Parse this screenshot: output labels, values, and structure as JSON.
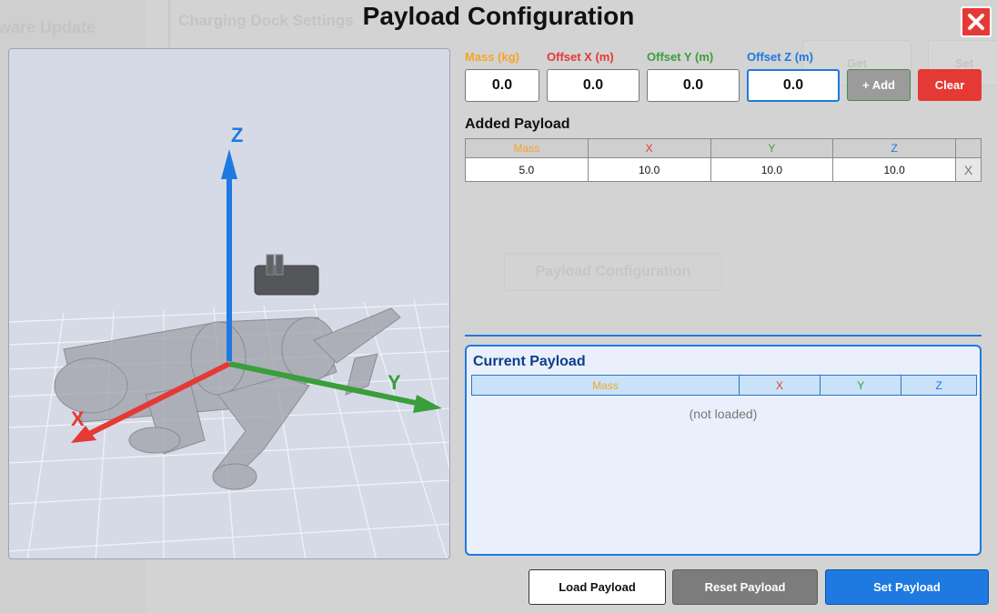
{
  "background": {
    "sidebar_title": "ware Update",
    "panel_title": "Charging Dock Settings",
    "ghost_buttons": [
      "Get",
      "Set"
    ],
    "ghost_center": "Payload Configuration"
  },
  "dialog": {
    "title": "Payload Configuration",
    "close_icon": "close-icon"
  },
  "viewport": {
    "axis_labels": {
      "x": "X",
      "y": "Y",
      "z": "Z"
    },
    "axis_colors": {
      "x": "#e53935",
      "y": "#3a9e3a",
      "z": "#1e7ae0"
    }
  },
  "inputs": {
    "mass": {
      "label": "Mass (kg)",
      "value": "0.0",
      "color": "#f5a623"
    },
    "offset_x": {
      "label": "Offset X (m)",
      "value": "0.0",
      "color": "#e53935"
    },
    "offset_y": {
      "label": "Offset Y (m)",
      "value": "0.0",
      "color": "#3a9e3a"
    },
    "offset_z": {
      "label": "Offset Z (m)",
      "value": "0.0",
      "color": "#1e7ae0"
    }
  },
  "buttons": {
    "add": "+ Add",
    "clear": "Clear",
    "load": "Load Payload",
    "reset": "Reset Payload",
    "set": "Set Payload"
  },
  "added_payload": {
    "title": "Added Payload",
    "headers": [
      "Mass",
      "X",
      "Y",
      "Z"
    ],
    "rows": [
      {
        "mass": "5.0",
        "x": "10.0",
        "y": "10.0",
        "z": "10.0",
        "remove": "X"
      }
    ]
  },
  "current_payload": {
    "title": "Current Payload",
    "headers": [
      "Mass",
      "X",
      "Y",
      "Z"
    ],
    "empty_text": "(not loaded)"
  }
}
